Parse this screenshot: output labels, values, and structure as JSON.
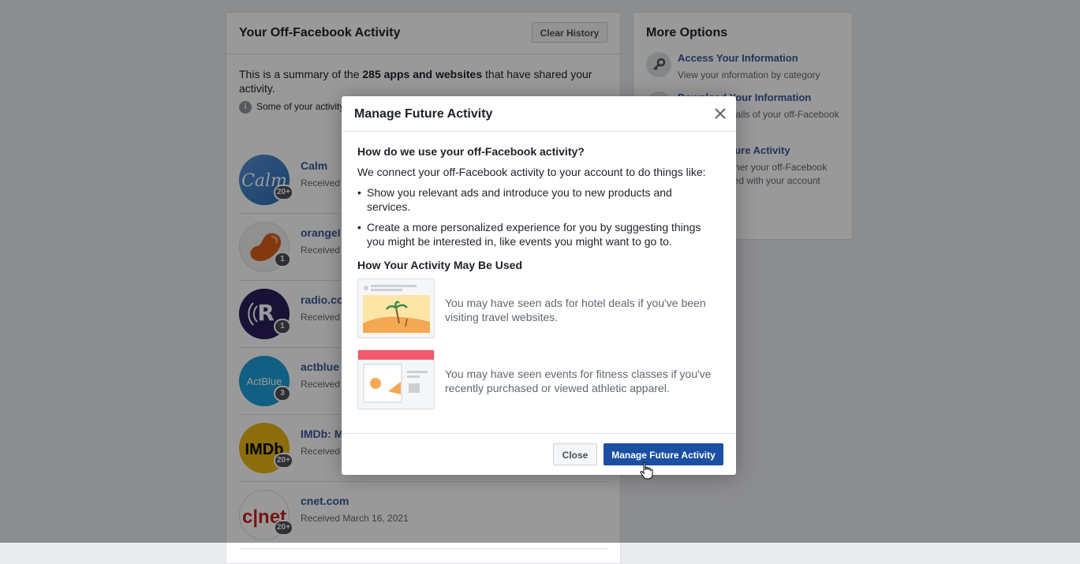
{
  "activity_card": {
    "title": "Your Off-Facebook Activity",
    "clear_label": "Clear History",
    "summary_pre": "This is a summary of the ",
    "summary_bold": "285 apps and websites",
    "summary_post": " that have shared your activity.",
    "info_text": "Some of your activity"
  },
  "apps": [
    {
      "name": "Calm",
      "date": "Received",
      "badge": "20+",
      "logo_text": "Calm",
      "color": "#3a7bd5"
    },
    {
      "name": "orangeI",
      "date": "Received",
      "badge": "1",
      "logo_text": "",
      "color": "#f0f0f0"
    },
    {
      "name": "radio.co",
      "date": "Received",
      "badge": "1",
      "logo_text": "R",
      "color": "#2b1f5a"
    },
    {
      "name": "actblue",
      "date": "Received",
      "badge": "3",
      "logo_text": "ActBlue",
      "color": "#1d9fd9"
    },
    {
      "name": "IMDb: M",
      "date": "Received",
      "badge": "20+",
      "logo_text": "IMDb",
      "color": "#e8b613"
    },
    {
      "name": "cnet.com",
      "date": "Received March 16, 2021",
      "badge": "20+",
      "logo_text": "c|net",
      "color": "#ffffff"
    }
  ],
  "more_options": {
    "title": "More Options",
    "items": [
      {
        "link": "Access Your Information",
        "desc": "View your information by category"
      },
      {
        "link": "Download Your Information",
        "desc": "Download details of your off-Facebook activity"
      },
      {
        "link": "Manage Future Activity",
        "desc": "Manage whether your off-Facebook activity is saved with your account"
      }
    ]
  },
  "modal": {
    "title": "Manage Future Activity",
    "question": "How do we use your off-Facebook activity?",
    "intro": "We connect your off-Facebook activity to your account to do things like:",
    "bullets": [
      "Show you relevant ads and introduce you to new products and services.",
      "Create a more personalized experience for you by suggesting things you might be interested in, like events you might want to go to."
    ],
    "subheading": "How Your Activity May Be Used",
    "examples": [
      {
        "text": "You may have seen ads for hotel deals if you've been visiting travel websites.",
        "icon": "beach-ad-illustration"
      },
      {
        "text": "You may have seen events for fitness classes if you've recently purchased or viewed athletic apparel.",
        "icon": "fitness-event-illustration"
      }
    ],
    "close_label": "Close",
    "primary_label": "Manage Future Activity"
  },
  "colors": {
    "link": "#385898",
    "primary": "#1a4fa3"
  }
}
